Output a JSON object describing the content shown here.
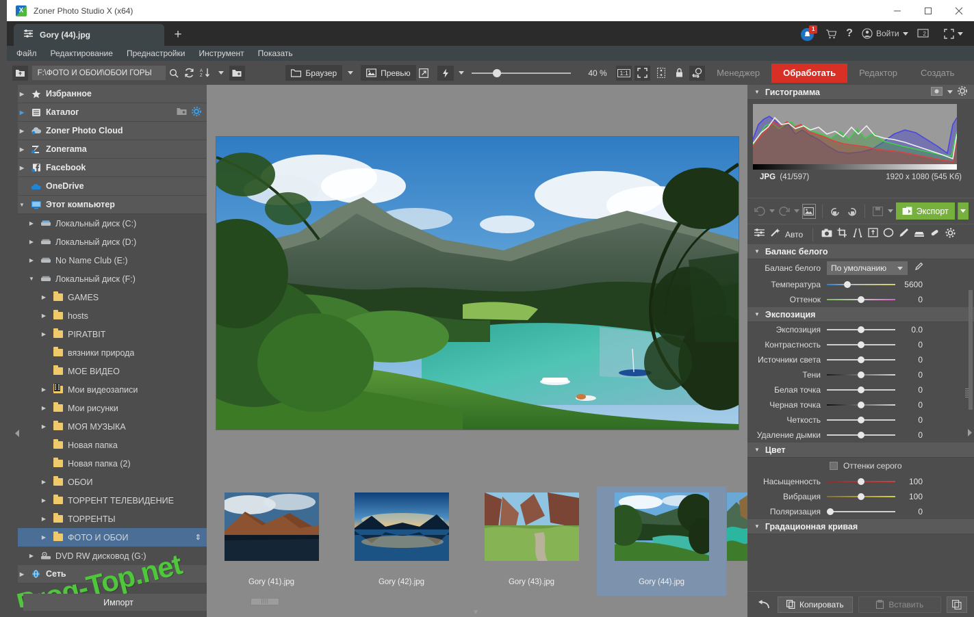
{
  "window": {
    "title": "Zoner Photo Studio X (x64)",
    "minimize": "–",
    "maximize": "□",
    "close": "✕"
  },
  "tab": {
    "label": "Gory (44).jpg",
    "new_tab": "+"
  },
  "topbar": {
    "notification_badge": "1",
    "signin_label": "Войти",
    "screen_label": "2",
    "icons": [
      "bell-icon",
      "cart-icon",
      "help-icon",
      "account-icon",
      "screen-icon",
      "fullscreen-icon"
    ]
  },
  "menu": {
    "items": [
      "Файл",
      "Редактирование",
      "Преднастройки",
      "Инструмент",
      "Показать"
    ]
  },
  "toolbar": {
    "path_value": "F:\\ФОТО И ОБОИ\\ОБОИ ГОРЫ",
    "browser_label": "Браузер",
    "preview_label": "Превью",
    "zoom_value": "40 %",
    "zoom_percent": 40,
    "icons": [
      "up-folder-icon",
      "search-icon",
      "refresh-icon",
      "sort-az-icon",
      "new-folder-icon",
      "open-external-icon",
      "flash-icon",
      "fit-1to1-icon",
      "fit-screen-icon",
      "compare-icon",
      "lock-icon",
      "before-after-icon"
    ]
  },
  "modules": {
    "tabs": [
      {
        "label": "Менеджер",
        "active": false
      },
      {
        "label": "Обработать",
        "active": true
      },
      {
        "label": "Редактор",
        "active": false
      },
      {
        "label": "Создать",
        "active": false
      }
    ],
    "accent_color": "#d93025"
  },
  "sidebar": {
    "top_items": [
      {
        "label": "Избранное",
        "icon": "star-icon",
        "arrow": "collapsed"
      },
      {
        "label": "Каталог",
        "icon": "catalog-icon",
        "arrow": "collapsed-blue",
        "actions": [
          "add-folder-icon",
          "gear-icon"
        ]
      },
      {
        "label": "Zoner Photo Cloud",
        "icon": "cloud-icon",
        "arrow": "collapsed"
      },
      {
        "label": "Zonerama",
        "icon": "zonerama-icon",
        "arrow": "collapsed"
      },
      {
        "label": "Facebook",
        "icon": "facebook-icon",
        "arrow": "collapsed"
      },
      {
        "label": "OneDrive",
        "icon": "onedrive-icon",
        "arrow": "none"
      },
      {
        "label": "Этот компьютер",
        "icon": "computer-icon",
        "arrow": "expanded"
      }
    ],
    "drives": [
      {
        "label": "Локальный диск (C:)",
        "arrow": "collapsed",
        "indent": 1,
        "icon": "drive-icon"
      },
      {
        "label": "Локальный диск (D:)",
        "arrow": "collapsed",
        "indent": 1,
        "icon": "drive-icon"
      },
      {
        "label": "No Name Club (E:)",
        "arrow": "collapsed",
        "indent": 1,
        "icon": "drive-icon"
      },
      {
        "label": "Локальный диск (F:)",
        "arrow": "expanded",
        "indent": 1,
        "icon": "drive-icon"
      },
      {
        "label": "GAMES",
        "arrow": "collapsed",
        "indent": 2,
        "icon": "folder-icon"
      },
      {
        "label": "hosts",
        "arrow": "collapsed",
        "indent": 2,
        "icon": "folder-icon"
      },
      {
        "label": "PIRATBIT",
        "arrow": "collapsed",
        "indent": 2,
        "icon": "folder-icon"
      },
      {
        "label": "вязники природа",
        "arrow": "none",
        "indent": 2,
        "icon": "folder-icon"
      },
      {
        "label": "МОЕ ВИДЕО",
        "arrow": "none",
        "indent": 2,
        "icon": "folder-icon"
      },
      {
        "label": "Мои видеозаписи",
        "arrow": "collapsed",
        "indent": 2,
        "icon": "folder-special-icon"
      },
      {
        "label": "Мои рисунки",
        "arrow": "collapsed",
        "indent": 2,
        "icon": "folder-icon"
      },
      {
        "label": "МОЯ МУЗЫКА",
        "arrow": "collapsed",
        "indent": 2,
        "icon": "folder-icon"
      },
      {
        "label": "Новая папка",
        "arrow": "none",
        "indent": 2,
        "icon": "folder-icon"
      },
      {
        "label": "Новая папка (2)",
        "arrow": "none",
        "indent": 2,
        "icon": "folder-icon"
      },
      {
        "label": "ОБОИ",
        "arrow": "collapsed",
        "indent": 2,
        "icon": "folder-icon"
      },
      {
        "label": "ТОРРЕНТ ТЕЛЕВИДЕНИЕ",
        "arrow": "collapsed",
        "indent": 2,
        "icon": "folder-icon"
      },
      {
        "label": "ТОРРЕНТЫ",
        "arrow": "collapsed",
        "indent": 2,
        "icon": "folder-icon"
      },
      {
        "label": "ФОТО И ОБОИ",
        "arrow": "collapsed",
        "indent": 2,
        "icon": "folder-icon",
        "selected": true
      },
      {
        "label": "DVD RW дисковод (G:)",
        "arrow": "collapsed",
        "indent": 1,
        "icon": "dvd-icon"
      }
    ],
    "network": {
      "label": "Сеть",
      "icon": "network-icon",
      "arrow": "collapsed"
    },
    "import_button": "Импорт"
  },
  "watermark": {
    "text": "Prog-Top.net",
    "color": "#4ec73a"
  },
  "filmstrip": {
    "items": [
      {
        "name": "Gory (41).jpg",
        "selected": false
      },
      {
        "name": "Gory (42).jpg",
        "selected": false
      },
      {
        "name": "Gory (43).jpg",
        "selected": false
      },
      {
        "name": "Gory (44).jpg",
        "selected": true
      },
      {
        "name": "",
        "selected": false
      }
    ]
  },
  "right_panel": {
    "histogram": {
      "title": "Гистограмма",
      "format": "JPG",
      "counter": "(41/597)",
      "dimensions": "1920 x 1080 (545 Kб)"
    },
    "actions": {
      "export_label": "Экспорт",
      "export_color": "#76b13e",
      "icons": [
        "undo-icon",
        "redo-icon",
        "picture-icon",
        "rotate-left-icon",
        "rotate-right-icon",
        "save-icon"
      ]
    },
    "tools": {
      "auto_label": "Авто",
      "icons": [
        "sliders-icon",
        "magic-wand-icon",
        "camera-icon",
        "crop-icon",
        "straighten-icon",
        "perspective-icon",
        "ellipse-icon",
        "brush-icon",
        "gradient-icon",
        "clone-stamp-icon",
        "gear-icon"
      ]
    },
    "white_balance": {
      "title": "Баланс белого",
      "preset_label": "Баланс белого",
      "preset_value": "По умолчанию",
      "sliders": [
        {
          "label": "Температура",
          "value": "5600",
          "pos": 30,
          "track": "temp"
        },
        {
          "label": "Оттенок",
          "value": "0",
          "pos": 50,
          "track": "tint"
        }
      ]
    },
    "exposure": {
      "title": "Экспозиция",
      "sliders": [
        {
          "label": "Экспозиция",
          "value": "0.0",
          "pos": 50,
          "track": "plain"
        },
        {
          "label": "Контрастность",
          "value": "0",
          "pos": 50,
          "track": "plain"
        },
        {
          "label": "Источники света",
          "value": "0",
          "pos": 50,
          "track": "plain"
        },
        {
          "label": "Тени",
          "value": "0",
          "pos": 50,
          "track": "dark"
        },
        {
          "label": "Белая точка",
          "value": "0",
          "pos": 50,
          "track": "plain"
        },
        {
          "label": "Черная точка",
          "value": "0",
          "pos": 50,
          "track": "dark"
        },
        {
          "label": "Четкость",
          "value": "0",
          "pos": 50,
          "track": "plain"
        },
        {
          "label": "Удаление дымки",
          "value": "0",
          "pos": 50,
          "track": "plain"
        }
      ]
    },
    "color": {
      "title": "Цвет",
      "grayscale_label": "Оттенки серого",
      "grayscale_checked": false,
      "sliders": [
        {
          "label": "Насыщенность",
          "value": "100",
          "pos": 50,
          "track": "sat"
        },
        {
          "label": "Вибрация",
          "value": "100",
          "pos": 50,
          "track": "vib"
        },
        {
          "label": "Поляризация",
          "value": "0",
          "pos": 3,
          "track": "plain"
        }
      ]
    },
    "curve": {
      "title": "Градационная кривая"
    },
    "bottom": {
      "copy_label": "Копировать",
      "paste_label": "Вставить",
      "icons": [
        "reset-icon",
        "copy-icon",
        "paste-icon",
        "batch-icon"
      ]
    }
  }
}
